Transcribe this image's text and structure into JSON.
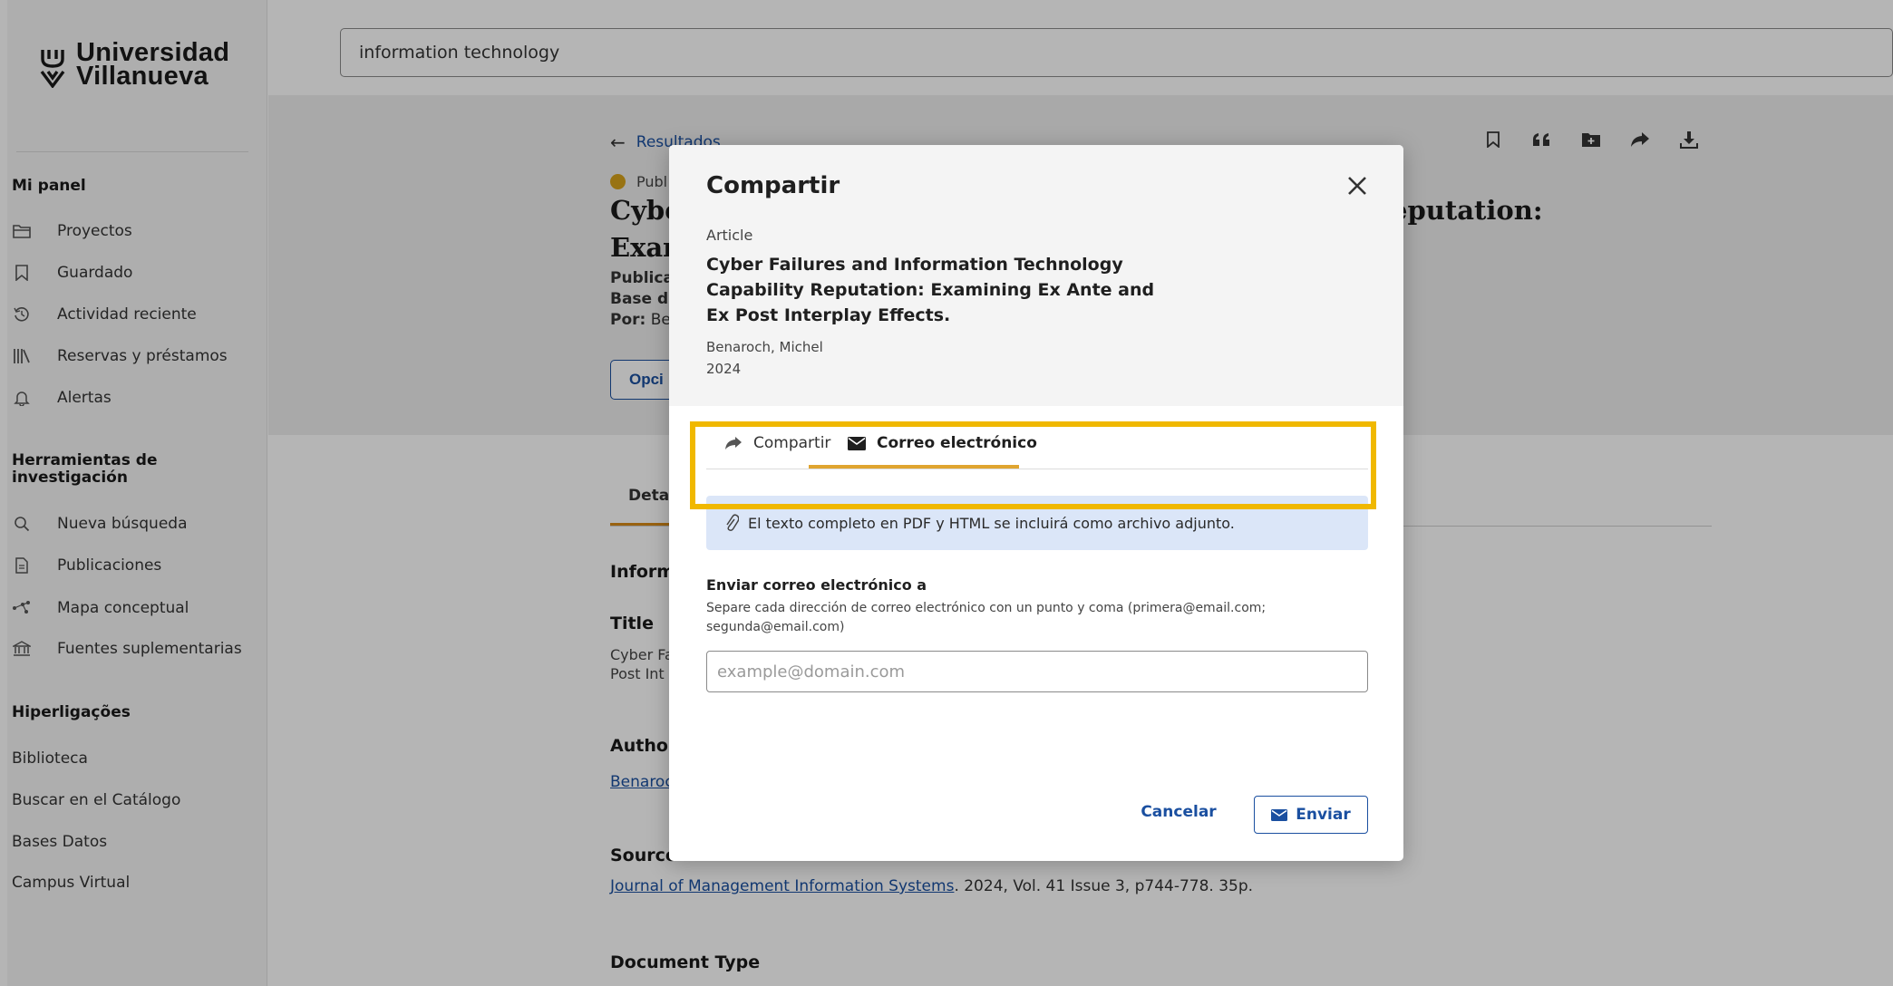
{
  "brand": {
    "line1": "Universidad",
    "line2": "Villanueva"
  },
  "search": {
    "value": "information technology"
  },
  "sidebar": {
    "panel_heading": "Mi panel",
    "panel_items": [
      {
        "label": "Proyectos",
        "icon": "folder-icon"
      },
      {
        "label": "Guardado",
        "icon": "bookmark-icon"
      },
      {
        "label": "Actividad reciente",
        "icon": "history-icon"
      },
      {
        "label": "Reservas y préstamos",
        "icon": "library-icon"
      },
      {
        "label": "Alertas",
        "icon": "bell-icon"
      }
    ],
    "tools_heading_1": "Herramientas de",
    "tools_heading_2": "investigación",
    "tools_items": [
      {
        "label": "Nueva búsqueda",
        "icon": "search-icon"
      },
      {
        "label": "Publicaciones",
        "icon": "document-icon"
      },
      {
        "label": "Mapa conceptual",
        "icon": "concept-map-icon"
      },
      {
        "label": "Fuentes suplementarias",
        "icon": "institution-icon"
      }
    ],
    "links_heading": "Hiperligações",
    "links": [
      "Biblioteca",
      "Buscar en el Catálogo",
      "Bases Datos",
      "Campus Virtual"
    ]
  },
  "record": {
    "back_label": "Resultados",
    "pub_badge": "Publ",
    "title_line1": "Cybe",
    "title_line2": "Exar",
    "title_right": "eputation:",
    "meta_line1": "Publica",
    "meta_line2": "Base d",
    "meta_line3_label": "Por:",
    "meta_line3_value": "Be",
    "opciones_label": "Opci",
    "detail_tab": "Detal",
    "info_head": "Inform",
    "title_head": "Title",
    "title_text_1": "Cyber Fa",
    "title_text_2": "Post Int",
    "author_head": "Author",
    "author_link": "Benaroc",
    "source_head": "Source",
    "source_link": "Journal of Management Information Systems",
    "source_rest": ". 2024, Vol. 41 Issue 3, p744-778. 35p.",
    "doctype_head": "Document Type"
  },
  "modal": {
    "title": "Compartir",
    "article_type": "Article",
    "article_title": "Cyber Failures and Information Technology Capability Reputation: Examining Ex Ante and Ex Post Interplay Effects.",
    "author": "Benaroch, Michel",
    "year": "2024",
    "tab_share": "Compartir",
    "tab_email": "Correo electrónico",
    "banner_text": "El texto completo en PDF y HTML se incluirá como archivo adjunto.",
    "send_label": "Enviar correo electrónico a",
    "send_help": "Separe cada dirección de correo electrónico con un punto y coma (primera@email.com; segunda@email.com)",
    "email_placeholder": "example@domain.com",
    "cancel_label": "Cancelar",
    "send_button": "Enviar"
  },
  "colors": {
    "accent_blue": "#1a4fa0",
    "tab_underline": "#e0a530",
    "highlight": "#f0b800",
    "banner_bg": "#dbe6f8"
  }
}
